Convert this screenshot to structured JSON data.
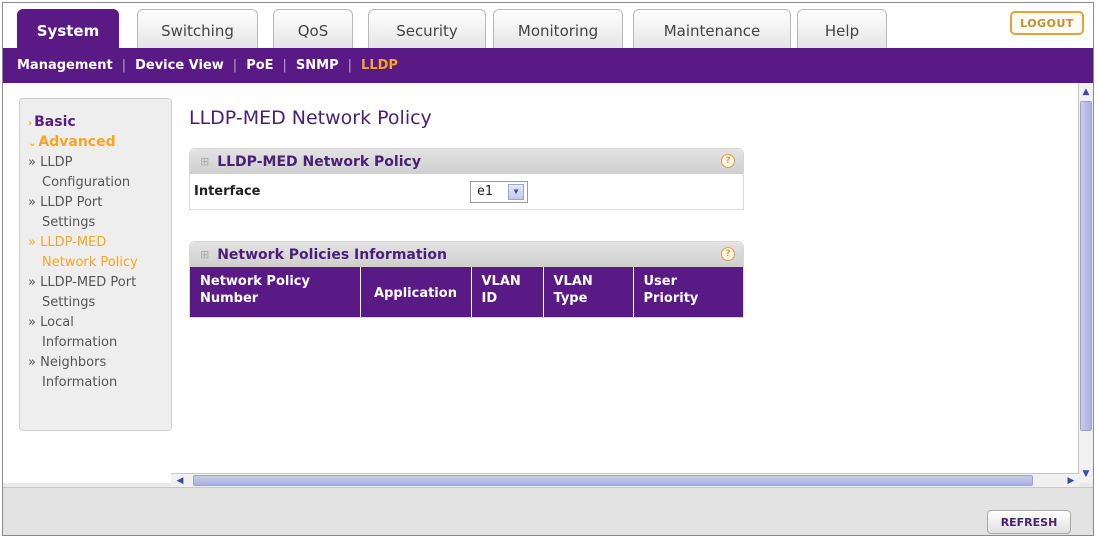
{
  "tabs": [
    {
      "label": "System",
      "active": true
    },
    {
      "label": "Switching",
      "active": false
    },
    {
      "label": "QoS",
      "active": false
    },
    {
      "label": "Security",
      "active": false
    },
    {
      "label": "Monitoring",
      "active": false
    },
    {
      "label": "Maintenance",
      "active": false
    },
    {
      "label": "Help",
      "active": false
    }
  ],
  "logout_label": "LOGOUT",
  "subnav": [
    {
      "label": "Management",
      "active": false
    },
    {
      "label": "Device View",
      "active": false
    },
    {
      "label": "PoE",
      "active": false
    },
    {
      "label": "SNMP",
      "active": false
    },
    {
      "label": "LLDP",
      "active": true
    }
  ],
  "sidebar": {
    "basic": "Basic",
    "advanced": "Advanced",
    "items": [
      {
        "prefix": "»",
        "line1": "LLDP",
        "line2": "Configuration",
        "active": false
      },
      {
        "prefix": "»",
        "line1": "LLDP Port",
        "line2": "Settings",
        "active": false
      },
      {
        "prefix": "»",
        "line1": "LLDP-MED",
        "line2": "Network Policy",
        "active": true
      },
      {
        "prefix": "»",
        "line1": "LLDP-MED Port",
        "line2": "Settings",
        "active": false
      },
      {
        "prefix": "»",
        "line1": "Local",
        "line2": "Information",
        "active": false
      },
      {
        "prefix": "»",
        "line1": "Neighbors",
        "line2": "Information",
        "active": false
      }
    ]
  },
  "page_title": "LLDP-MED Network Policy",
  "panel1": {
    "title": "LLDP-MED Network Policy",
    "help": "?",
    "interface_label": "Interface",
    "interface_value": "e1"
  },
  "panel2": {
    "title": "Network Policies Information",
    "help": "?",
    "columns": [
      {
        "line1": "Network Policy",
        "line2": "Number"
      },
      {
        "line1": "Application",
        "line2": ""
      },
      {
        "line1": "VLAN",
        "line2": "ID"
      },
      {
        "line1": "VLAN",
        "line2": "Type"
      },
      {
        "line1": "User",
        "line2": "Priority"
      }
    ]
  },
  "refresh_label": "REFRESH",
  "colors": {
    "brand_purple": "#5a1a86",
    "accent_orange": "#f5a623"
  }
}
